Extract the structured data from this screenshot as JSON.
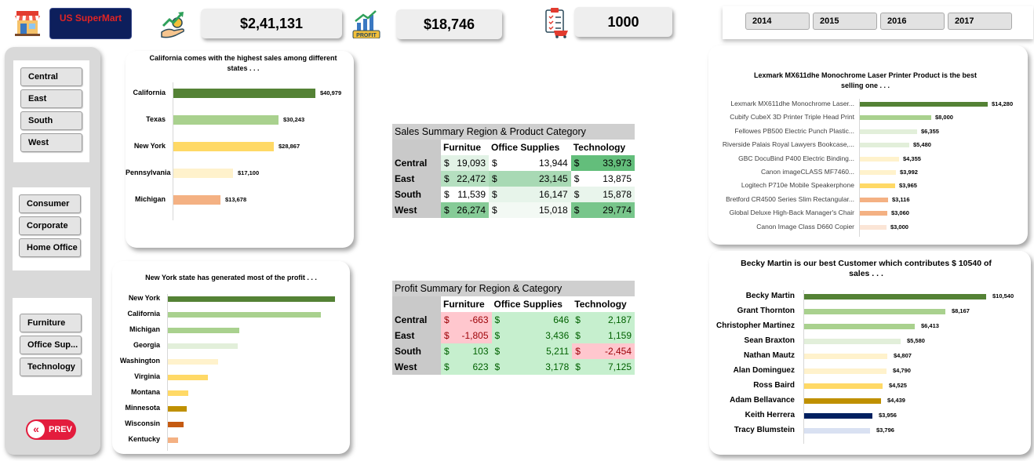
{
  "header": {
    "brand": "US SuperMart",
    "kpis": [
      {
        "value": "$2,41,131"
      },
      {
        "value": "$18,746"
      },
      {
        "value": "1000"
      }
    ],
    "profit_icon_label": "PROFIT",
    "years": [
      "2014",
      "2015",
      "2016",
      "2017"
    ]
  },
  "sidebar": {
    "regions": [
      "Central",
      "East",
      "South",
      "West"
    ],
    "segments": [
      "Consumer",
      "Corporate",
      "Home Office"
    ],
    "categories": [
      "Furniture",
      "Office Sup...",
      "Technology"
    ],
    "prev_label": "PREV"
  },
  "colors": {
    "dark_green": "#548235",
    "light_green": "#a9d18e",
    "pale_green": "#e2efda",
    "yellow": "#ffd966",
    "pale_yellow": "#fff2cc",
    "orange": "#f4b183",
    "gold": "#bf9000",
    "dark_orange": "#c55a11",
    "navy": "#002060",
    "lavender": "#d9e1f2",
    "table_green": "#63be7b",
    "table_red": "#ffc7ce",
    "neg_text": "#9c0006",
    "pos_text": "#006100"
  },
  "chart_data": [
    {
      "type": "bar",
      "orientation": "horizontal",
      "title": "California comes with the highest sales among different states . . .",
      "categories": [
        "California",
        "Texas",
        "New York",
        "Pennsylvania",
        "Michigan"
      ],
      "values": [
        40979,
        30243,
        28867,
        17100,
        13678
      ],
      "value_labels": [
        "$40,979",
        "$30,243",
        "$28,867",
        "$17,100",
        "$13,678"
      ],
      "xlim": [
        0,
        43000
      ]
    },
    {
      "type": "bar",
      "orientation": "horizontal",
      "title": "New York state has generated most of the profit  . . .",
      "categories": [
        "New York",
        "California",
        "Michigan",
        "Georgia",
        "Washington",
        "Virginia",
        "Montana",
        "Minnesota",
        "Wisconsin",
        "Kentucky"
      ],
      "values": [
        22000,
        20100,
        9450,
        9150,
        6600,
        5300,
        2700,
        2500,
        2050,
        1350
      ],
      "xlim": [
        0,
        22000
      ]
    },
    {
      "type": "bar",
      "orientation": "horizontal",
      "title": "Lexmark MX611dhe Monochrome Laser Printer Product is the best selling one . . .",
      "categories": [
        "Lexmark MX611dhe Monochrome Laser...",
        "Cubify CubeX 3D Printer Triple Head Print",
        "Fellowes PB500 Electric Punch Plastic...",
        "Riverside Palais Royal Lawyers Bookcase,...",
        "GBC DocuBind P400 Electric Binding...",
        "Canon imageCLASS MF7460...",
        "Logitech P710e Mobile Speakerphone",
        "Bretford CR4500 Series Slim Rectangular...",
        "Global Deluxe High-Back Manager's Chair",
        "Canon Image Class D660 Copier"
      ],
      "values": [
        14280,
        8000,
        6355,
        5480,
        4355,
        3992,
        3965,
        3116,
        3060,
        3000
      ],
      "value_labels": [
        "$14,280",
        "$8,000",
        "$6,355",
        "$5,480",
        "$4,355",
        "$3,992",
        "$3,965",
        "$3,116",
        "$3,060",
        "$3,000"
      ],
      "xlim": [
        0,
        14280
      ]
    },
    {
      "type": "bar",
      "orientation": "horizontal",
      "title": "Becky Martin is our best Customer which contributes $ 10540 of sales . . .",
      "categories": [
        "Becky Martin",
        "Grant Thornton",
        "Christopher Martinez",
        "Sean Braxton",
        "Nathan Mautz",
        "Alan Dominguez",
        "Ross Baird",
        "Adam Bellavance",
        "Keith Herrera",
        "Tracy Blumstein"
      ],
      "values": [
        10540,
        8167,
        6413,
        5580,
        4807,
        4790,
        4525,
        4439,
        3956,
        3796
      ],
      "value_labels": [
        "$10,540",
        "$8,167",
        "$6,413",
        "$5,580",
        "$4,807",
        "$4,790",
        "$4,525",
        "$4,439",
        "$3,956",
        "$3,796"
      ],
      "xlim": [
        0,
        10540
      ]
    }
  ],
  "tables": [
    {
      "title": "Sales Summary Region & Product Category",
      "columns": [
        "Furnitue",
        "Office Supplies",
        "Technology"
      ],
      "currency": "$",
      "rows": [
        {
          "region": "Central",
          "values": [
            "19,093",
            "13,944",
            "33,973"
          ],
          "fills": [
            "#e2f2e6",
            "#ffffff",
            "#63be7b"
          ]
        },
        {
          "region": "East",
          "values": [
            "22,472",
            "23,145",
            "13,875"
          ],
          "fills": [
            "#b5dfc0",
            "#a8d9b4",
            "#ffffff"
          ]
        },
        {
          "region": "South",
          "values": [
            "11,539",
            "16,147",
            "15,878"
          ],
          "fills": [
            "#ffffff",
            "#e7f4ea",
            "#e9f5ec"
          ]
        },
        {
          "region": "West",
          "values": [
            "26,274",
            "15,018",
            "29,774"
          ],
          "fills": [
            "#86cb97",
            "#f3f9f4",
            "#78c68b"
          ]
        }
      ]
    },
    {
      "title": "Profit Summary for Region & Category",
      "columns": [
        "Furniture",
        "Office Supplies",
        "Technology"
      ],
      "currency": "$",
      "rows": [
        {
          "region": "Central",
          "values": [
            "-663",
            "646",
            "2,187"
          ],
          "fills": [
            "#ffc7ce",
            "#c6efce",
            "#c6efce"
          ],
          "text": [
            "#9c0006",
            "#006100",
            "#006100"
          ]
        },
        {
          "region": "East",
          "values": [
            "-1,805",
            "3,436",
            "1,159"
          ],
          "fills": [
            "#ffc7ce",
            "#c6efce",
            "#c6efce"
          ],
          "text": [
            "#9c0006",
            "#006100",
            "#006100"
          ]
        },
        {
          "region": "South",
          "values": [
            "103",
            "5,211",
            "-2,454"
          ],
          "fills": [
            "#c6efce",
            "#c6efce",
            "#ffc7ce"
          ],
          "text": [
            "#006100",
            "#006100",
            "#9c0006"
          ]
        },
        {
          "region": "West",
          "values": [
            "623",
            "3,178",
            "7,125"
          ],
          "fills": [
            "#c6efce",
            "#c6efce",
            "#c6efce"
          ],
          "text": [
            "#006100",
            "#006100",
            "#006100"
          ]
        }
      ]
    }
  ]
}
